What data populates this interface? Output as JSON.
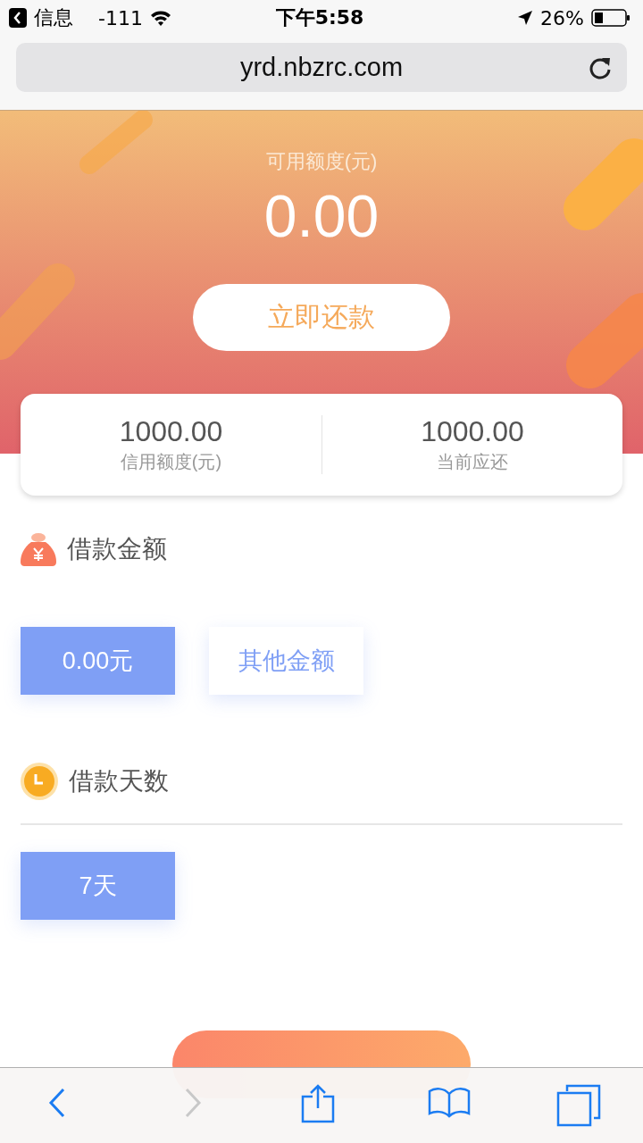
{
  "status_bar": {
    "back_app": "信息",
    "signal": "-111",
    "time": "下午5:58",
    "battery": "26%"
  },
  "address_bar": {
    "url": "yrd.nbzrc.com"
  },
  "hero": {
    "label": "可用额度(元)",
    "amount": "0.00",
    "button": "立即还款"
  },
  "summary": [
    {
      "value": "1000.00",
      "label": "信用额度(元)"
    },
    {
      "value": "1000.00",
      "label": "当前应还"
    }
  ],
  "sections": [
    {
      "kind": "amount",
      "title": "借款金额",
      "options": [
        {
          "label": "0.00元",
          "selected": true
        },
        {
          "label": "其他金额",
          "selected": false
        }
      ]
    },
    {
      "kind": "days",
      "title": "借款天数",
      "options": [
        {
          "label": "7天",
          "selected": true
        }
      ]
    }
  ],
  "toolbar": [
    {
      "kind": "back",
      "disabled": false
    },
    {
      "kind": "forward",
      "disabled": true
    },
    {
      "kind": "share",
      "disabled": false
    },
    {
      "kind": "bookmarks",
      "disabled": false
    },
    {
      "kind": "tabs",
      "disabled": false
    }
  ]
}
